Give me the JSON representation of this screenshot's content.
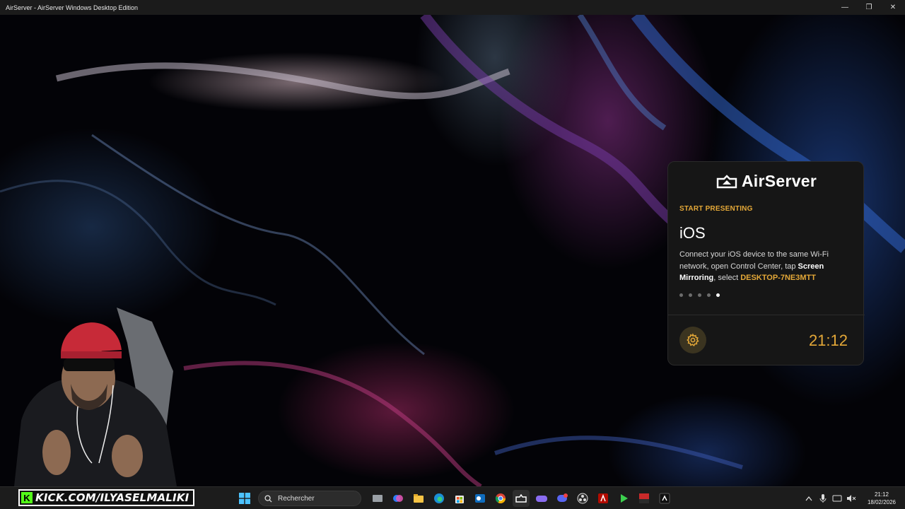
{
  "window": {
    "title": "AirServer - AirServer Windows Desktop Edition",
    "minimize_glyph": "—",
    "restore_glyph": "❐",
    "close_glyph": "✕"
  },
  "panel": {
    "brand": "AirServer",
    "section_label": "START PRESENTING",
    "platform": "iOS",
    "desc_part1": "Connect your iOS device to the same Wi-Fi network, open Control Center, tap ",
    "desc_bold": "Screen Mirroring",
    "desc_part2": ", select ",
    "device_name": "DESKTOP-7NE3MTT",
    "carousel": {
      "count": 5,
      "active_index": 4
    },
    "clock": "21:12",
    "settings_icon": "gear-icon"
  },
  "overlay": {
    "kick_logo": "K",
    "kick_text": "KICK.COM/ILYASELMALIKI"
  },
  "taskbar": {
    "search_placeholder": "Rechercher",
    "apps": [
      "file-manager-icon",
      "copilot-icon",
      "file-explorer-icon",
      "edge-icon",
      "store-icon",
      "outlook-icon",
      "chrome-icon",
      "airserver-icon",
      "game-controller-icon",
      "discord-icon",
      "obs-icon",
      "adobe-icon",
      "play-icon",
      "unknown-app-icon",
      "media-icon"
    ],
    "tray": {
      "time": "21:12",
      "date": "18/02/2026"
    }
  }
}
